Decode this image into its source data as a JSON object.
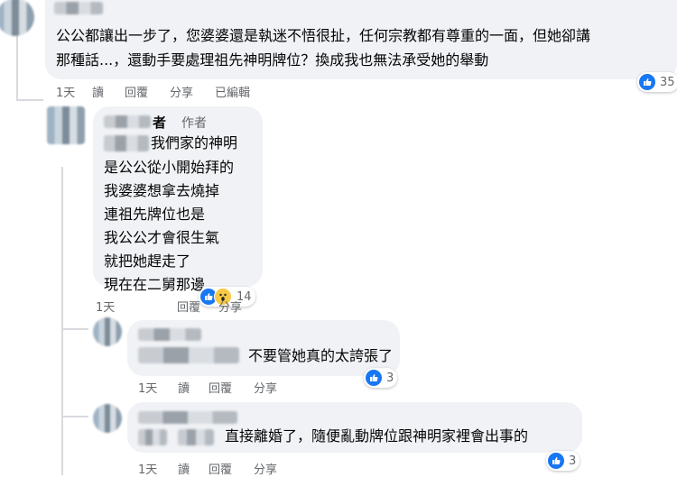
{
  "comments": [
    {
      "id": "c1",
      "text_line1": "公公都讓出一步了，您婆婆還是執迷不悟很扯，任何宗教都有尊重的一面，但她卻講",
      "text_line2": "那種話...，還動手要處理祖先神明牌位？換成我也無法承受她的舉動",
      "time": "1天",
      "read": "讀",
      "reply": "回覆",
      "share": "分享",
      "edited": "已編輯",
      "reactions": "35"
    },
    {
      "id": "c2",
      "name_suffix": "者",
      "author_tag": "作者",
      "lines": [
        "我們家的神明",
        "是公公從小開始拜的",
        "我婆婆想拿去燒掉",
        "連祖先牌位也是",
        "我公公才會很生氣",
        "就把她趕走了",
        "現在在二舅那邊"
      ],
      "time": "1天",
      "reply": "回覆",
      "share": "分享",
      "reactions": "14"
    },
    {
      "id": "c3",
      "text": "不要管她真的太誇張了",
      "time": "1天",
      "read": "讀",
      "reply": "回覆",
      "share": "分享",
      "reactions": "3"
    },
    {
      "id": "c4",
      "text": "直接離婚了，隨便亂動牌位跟神明家裡會出事的",
      "time": "1天",
      "read": "讀",
      "reply": "回覆",
      "share": "分享",
      "reactions": "3"
    }
  ],
  "colors": {
    "bubble": "#f0f2f5",
    "like": "#1877f2",
    "muted": "#65676b",
    "author": "#65676b"
  }
}
